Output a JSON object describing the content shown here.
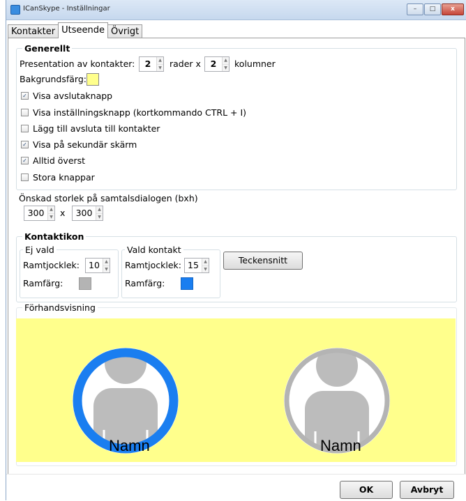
{
  "window": {
    "title": "ICanSkype - Inställningar"
  },
  "caption_buttons": {
    "minimize": "–",
    "maximize": "□",
    "close": "x"
  },
  "tabs": [
    {
      "label": "Kontakter"
    },
    {
      "label": "Utseende"
    },
    {
      "label": "Övrigt"
    }
  ],
  "active_tab": "Utseende",
  "generellt": {
    "legend": "Generellt",
    "presentation_label": "Presentation av kontakter:",
    "rows_value": "2",
    "rows_label": "rader x",
    "cols_value": "2",
    "cols_label": "kolumner",
    "bg_label": "Bakgrundsfärg:",
    "bg_color": "#ffff8c",
    "checkboxes": [
      {
        "label": "Visa avslutaknapp",
        "checked": true
      },
      {
        "label": "Visa inställningsknapp (kortkommando CTRL + I)",
        "checked": false
      },
      {
        "label": "Lägg till avsluta till kontakter",
        "checked": false
      },
      {
        "label": "Visa på sekundär skärm",
        "checked": true
      },
      {
        "label": "Alltid överst",
        "checked": true
      },
      {
        "label": "Stora knappar",
        "checked": false
      }
    ]
  },
  "dialog_size": {
    "label": "Önskad storlek på samtalsdialogen (bxh)",
    "width": "300",
    "x": "x",
    "height": "300"
  },
  "kontaktikon": {
    "legend": "Kontaktikon",
    "ej_vald": {
      "legend": "Ej vald",
      "thickness_label": "Ramtjocklek:",
      "thickness": "10",
      "color_label": "Ramfärg:",
      "color": "#b4b4b4"
    },
    "vald": {
      "legend": "Vald kontakt",
      "thickness_label": "Ramtjocklek:",
      "thickness": "15",
      "color_label": "Ramfärg:",
      "color": "#1a7ef0"
    },
    "font_button": "Teckensnitt"
  },
  "preview": {
    "legend": "Förhandsvisning",
    "contacts": [
      {
        "name": "Namn",
        "selected": true
      },
      {
        "name": "Namn",
        "selected": false
      }
    ]
  },
  "buttons": {
    "ok": "OK",
    "cancel": "Avbryt"
  },
  "icons": {
    "checkmark": "✓",
    "spin_up": "▲",
    "spin_down": "▼"
  }
}
